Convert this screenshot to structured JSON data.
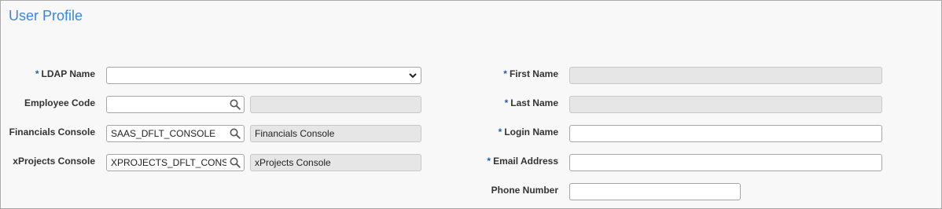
{
  "page": {
    "title": "User Profile"
  },
  "form": {
    "required_marker": "*",
    "ldap_name": {
      "label": "LDAP Name",
      "value": ""
    },
    "employee_code": {
      "label": "Employee Code",
      "value": "",
      "description": ""
    },
    "financials_console": {
      "label": "Financials Console",
      "value": "SAAS_DFLT_CONSOLE",
      "description": "Financials Console"
    },
    "xprojects_console": {
      "label": "xProjects Console",
      "value": "XPROJECTS_DFLT_CONS",
      "description": "xProjects Console"
    },
    "first_name": {
      "label": "First Name",
      "value": ""
    },
    "last_name": {
      "label": "Last Name",
      "value": ""
    },
    "login_name": {
      "label": "Login Name",
      "value": ""
    },
    "email_address": {
      "label": "Email Address",
      "value": ""
    },
    "phone_number": {
      "label": "Phone Number",
      "value": ""
    }
  },
  "colors": {
    "title": "#3b87d9",
    "required_marker": "#1a5fb4",
    "readonly_background": "#e6e6e6",
    "panel_background": "#f8f8f8"
  },
  "icons": {
    "lookup": "search-icon",
    "dropdown": "chevron-down-icon"
  }
}
